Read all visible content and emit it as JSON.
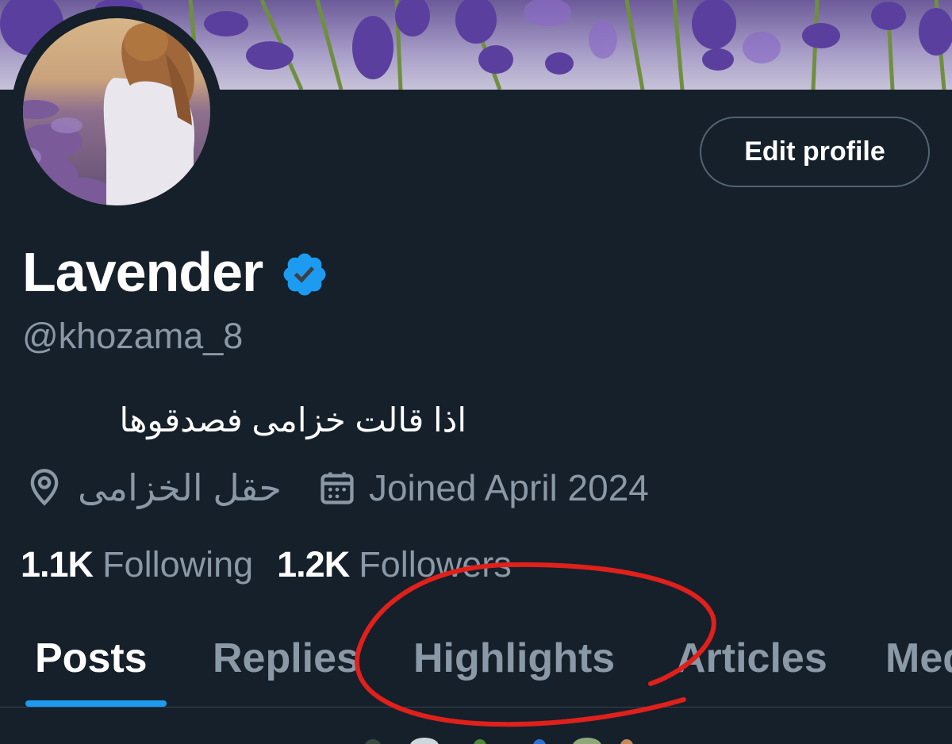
{
  "profile": {
    "display_name": "Lavender",
    "handle": "@khozama_8",
    "bio": "اذا قالت خزامى فصدقوها",
    "location": "حقل الخزامى",
    "joined": "Joined April 2024",
    "edit_label": "Edit profile"
  },
  "stats": {
    "following_count": "1.1K",
    "following_label": "Following",
    "followers_count": "1.2K",
    "followers_label": "Followers"
  },
  "tabs": [
    {
      "label": "Posts"
    },
    {
      "label": "Replies"
    },
    {
      "label": "Highlights"
    },
    {
      "label": "Articles"
    },
    {
      "label": "Media"
    }
  ],
  "active_tab": "Posts",
  "colors": {
    "background": "#15202b",
    "accent": "#1d9bf0",
    "muted_text": "#8b98a5",
    "annotation": "#e0201b"
  },
  "icons": [
    "verified-badge-icon",
    "location-pin-icon",
    "calendar-icon"
  ]
}
